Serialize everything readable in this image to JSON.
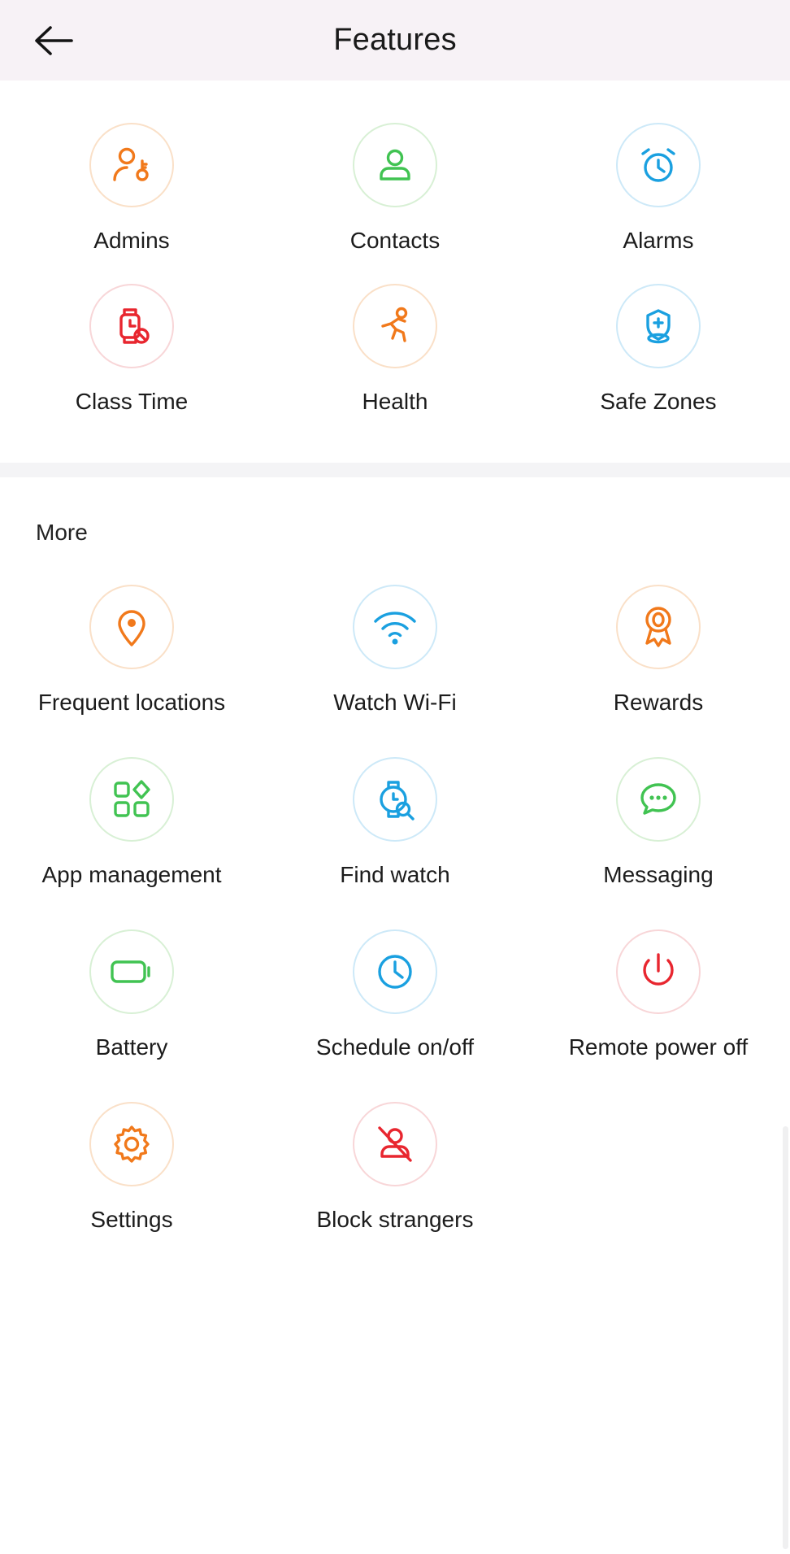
{
  "header": {
    "title": "Features",
    "back_icon": "arrow-left-icon"
  },
  "sections": [
    {
      "id": "primary",
      "heading": "",
      "items": [
        {
          "label": "Admins",
          "icon": "user-key-icon",
          "color": "#f1791b",
          "ring": "ring-orange"
        },
        {
          "label": "Contacts",
          "icon": "person-icon",
          "color": "#41c352",
          "ring": "ring-green"
        },
        {
          "label": "Alarms",
          "icon": "alarm-clock-icon",
          "color": "#1aa0e0",
          "ring": "ring-blue"
        },
        {
          "label": "Class Time",
          "icon": "watch-blocked-icon",
          "color": "#e8262f",
          "ring": "ring-red"
        },
        {
          "label": "Health",
          "icon": "running-person-icon",
          "color": "#f1791b",
          "ring": "ring-orange"
        },
        {
          "label": "Safe Zones",
          "icon": "shield-location-icon",
          "color": "#1aa0e0",
          "ring": "ring-blue"
        }
      ]
    },
    {
      "id": "more",
      "heading": "More",
      "items": [
        {
          "label": "Frequent locations",
          "icon": "map-pin-icon",
          "color": "#f1791b",
          "ring": "ring-orange"
        },
        {
          "label": "Watch Wi-Fi",
          "icon": "wifi-icon",
          "color": "#1aa0e0",
          "ring": "ring-blue"
        },
        {
          "label": "Rewards",
          "icon": "medal-icon",
          "color": "#f1791b",
          "ring": "ring-orange"
        },
        {
          "label": "App management",
          "icon": "app-grid-icon",
          "color": "#41c352",
          "ring": "ring-green"
        },
        {
          "label": "Find watch",
          "icon": "watch-search-icon",
          "color": "#1aa0e0",
          "ring": "ring-blue"
        },
        {
          "label": "Messaging",
          "icon": "chat-bubble-icon",
          "color": "#41c352",
          "ring": "ring-green"
        },
        {
          "label": "Battery",
          "icon": "battery-icon",
          "color": "#41c352",
          "ring": "ring-green"
        },
        {
          "label": "Schedule on/off",
          "icon": "clock-icon",
          "color": "#1aa0e0",
          "ring": "ring-blue"
        },
        {
          "label": "Remote power off",
          "icon": "power-icon",
          "color": "#e8262f",
          "ring": "ring-red"
        },
        {
          "label": "Settings",
          "icon": "gear-icon",
          "color": "#f1791b",
          "ring": "ring-orange"
        },
        {
          "label": "Block strangers",
          "icon": "person-blocked-icon",
          "color": "#e8262f",
          "ring": "ring-red"
        }
      ]
    }
  ],
  "colors": {
    "header_bg": "#f7f2f6",
    "divider_bg": "#f4f4f6",
    "text": "#1c1c1c",
    "orange": "#f1791b",
    "green": "#41c352",
    "blue": "#1aa0e0",
    "red": "#e8262f"
  }
}
